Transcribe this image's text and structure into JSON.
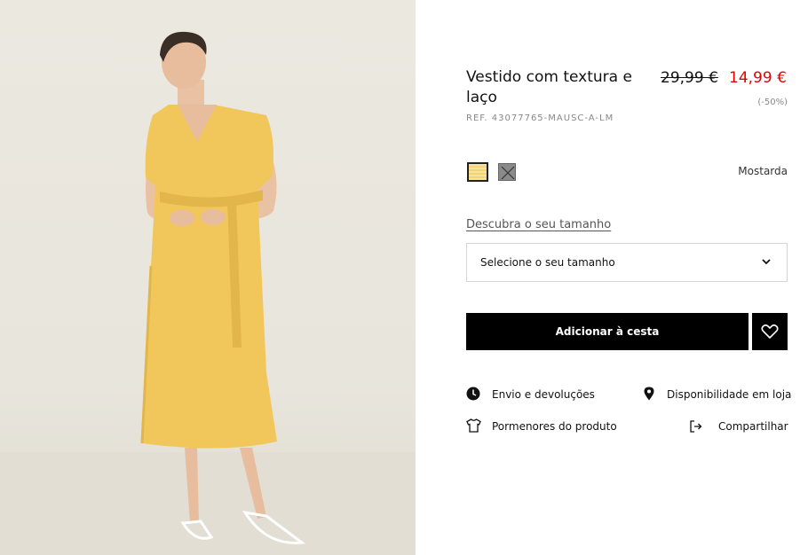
{
  "product": {
    "title": "Vestido com textura e laço",
    "ref": "REF. 43077765-MAUSC-A-LM",
    "price_old": "29,99 €",
    "price_new": "14,99 €",
    "discount": "(-50%)",
    "color_name": "Mostarda",
    "colors": {
      "mustard": "#f3d374",
      "grey": "#8a8a8a",
      "sale_red": "#e00000"
    }
  },
  "size": {
    "guide_link": "Descubra o seu tamanho",
    "select_label": "Selecione o seu tamanho"
  },
  "actions": {
    "add_to_cart": "Adicionar à cesta",
    "favorite_icon": "heart-icon"
  },
  "links": {
    "shipping": "Envio e devoluções",
    "availability": "Disponibilidade em loja",
    "details": "Pormenores do produto",
    "share": "Compartilhar"
  }
}
